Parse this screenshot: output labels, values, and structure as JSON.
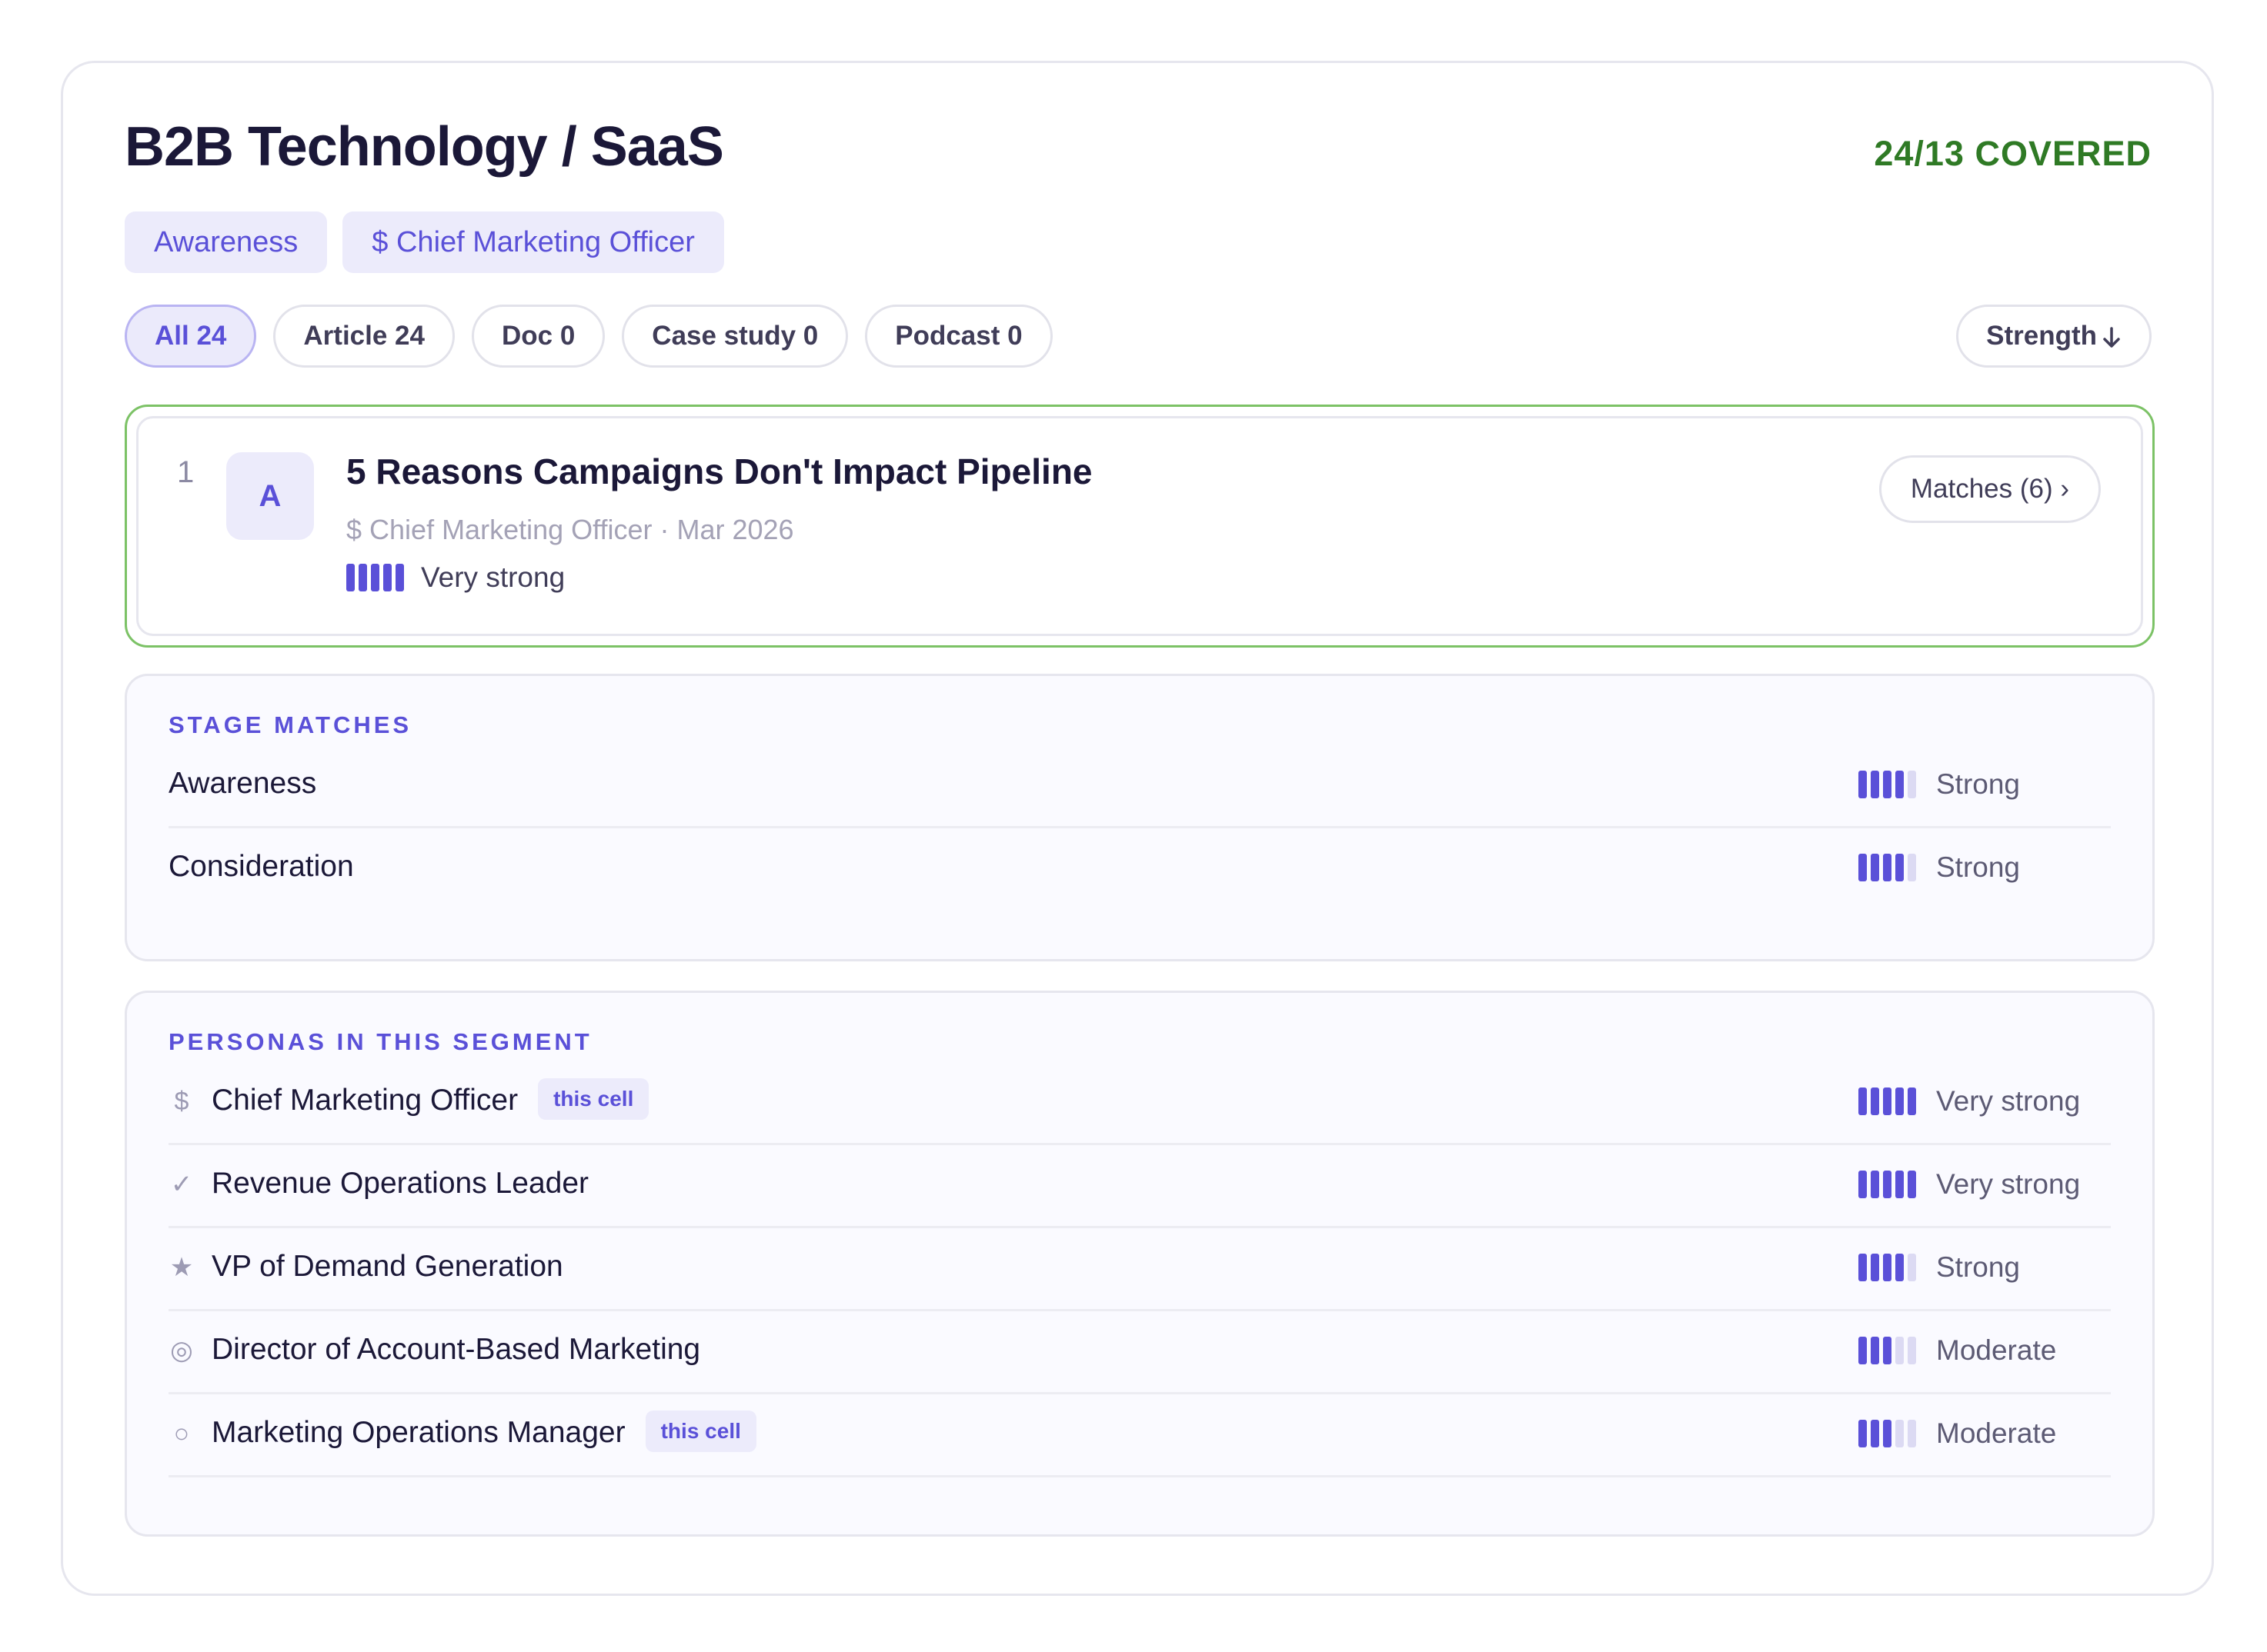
{
  "header": {
    "title": "B2B Technology / SaaS",
    "covered": "24/13 COVERED"
  },
  "tags": [
    "Awareness",
    "$ Chief Marketing Officer"
  ],
  "filters": [
    {
      "label": "All 24",
      "active": true
    },
    {
      "label": "Article 24",
      "active": false
    },
    {
      "label": "Doc 0",
      "active": false
    },
    {
      "label": "Case study 0",
      "active": false
    },
    {
      "label": "Podcast 0",
      "active": false
    }
  ],
  "sort": {
    "label": "Strength",
    "icon": "arrow-down-icon"
  },
  "result": {
    "rank": "1",
    "avatar": "A",
    "title": "5 Reasons Campaigns Don't Impact Pipeline",
    "meta": "$ Chief Marketing Officer · Mar 2026",
    "strength_label": "Very strong",
    "strength_level": 5,
    "matches_label": "Matches (6) ›"
  },
  "stage_matches": {
    "title": "STAGE MATCHES",
    "rows": [
      {
        "name": "Awareness",
        "strength": "Strong",
        "level": 4
      },
      {
        "name": "Consideration",
        "strength": "Strong",
        "level": 4
      }
    ]
  },
  "personas": {
    "title": "PERSONAS IN THIS SEGMENT",
    "rows": [
      {
        "icon": "dollar-icon",
        "glyph": "$",
        "name": "Chief Marketing Officer",
        "badge": "this cell",
        "strength": "Very strong",
        "level": 5
      },
      {
        "icon": "check-icon",
        "glyph": "✓",
        "name": "Revenue Operations Leader",
        "badge": "",
        "strength": "Very strong",
        "level": 5
      },
      {
        "icon": "star-icon",
        "glyph": "★",
        "name": "VP of Demand Generation",
        "badge": "",
        "strength": "Strong",
        "level": 4
      },
      {
        "icon": "target-icon",
        "glyph": "◎",
        "name": "Director of Account-Based Marketing",
        "badge": "",
        "strength": "Moderate",
        "level": 3
      },
      {
        "icon": "circle-icon",
        "glyph": "○",
        "name": "Marketing Operations Manager",
        "badge": "this cell",
        "strength": "Moderate",
        "level": 3
      }
    ]
  },
  "colors": {
    "accent": "#5a50d8",
    "covered_green": "#2f7a25",
    "selected_border": "#7cc266"
  }
}
